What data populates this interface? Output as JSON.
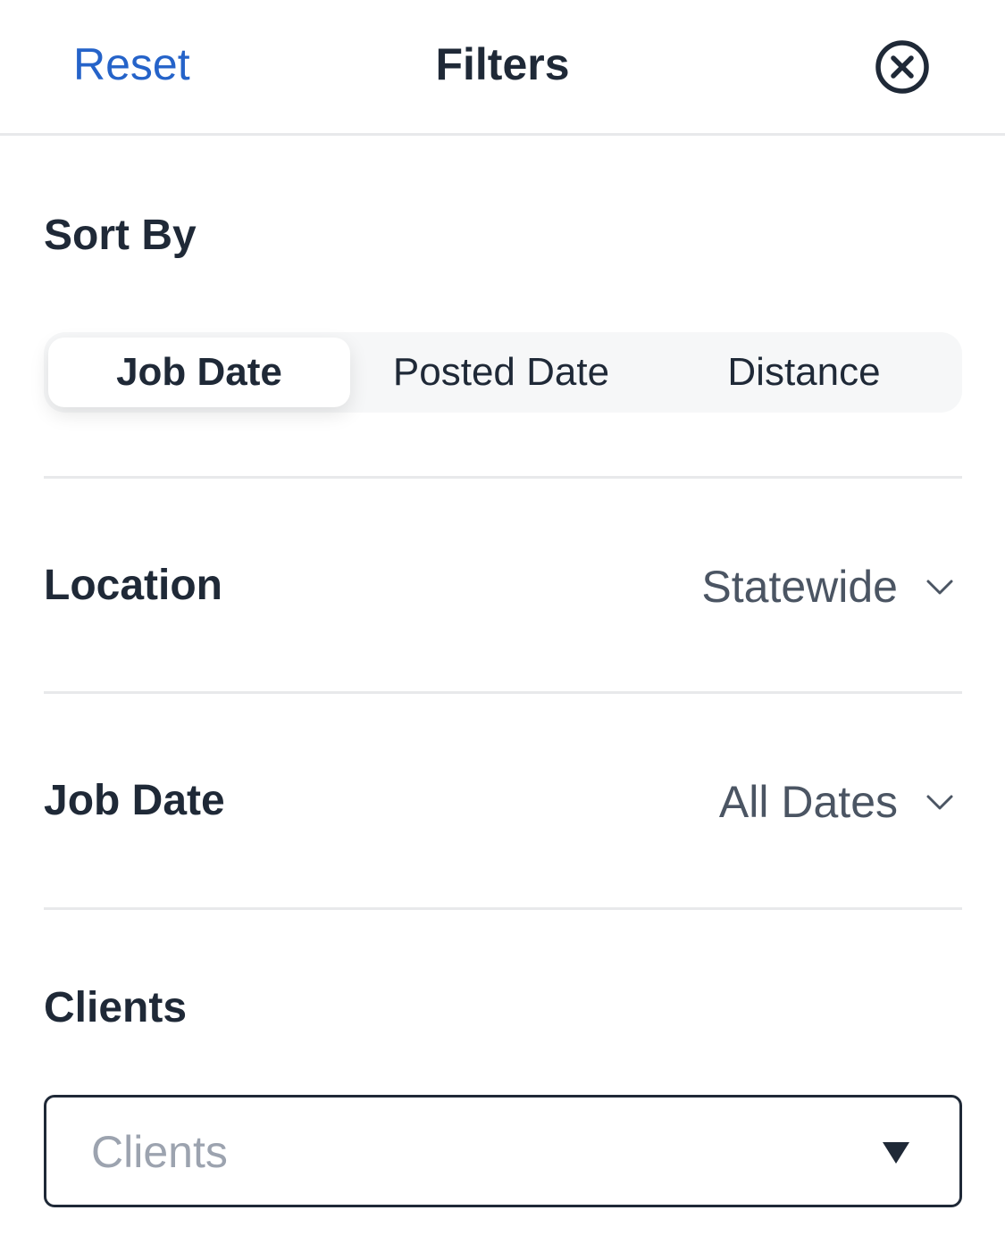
{
  "header": {
    "reset_label": "Reset",
    "title": "Filters",
    "close_icon": "close-circle-icon"
  },
  "sort_by": {
    "label": "Sort By",
    "options": [
      {
        "label": "Job Date",
        "selected": true
      },
      {
        "label": "Posted Date",
        "selected": false
      },
      {
        "label": "Distance",
        "selected": false
      }
    ]
  },
  "location": {
    "label": "Location",
    "value": "Statewide",
    "icon": "chevron-down-icon"
  },
  "job_date": {
    "label": "Job Date",
    "value": "All Dates",
    "icon": "chevron-down-icon"
  },
  "clients": {
    "label": "Clients",
    "placeholder": "Clients",
    "icon": "caret-down-icon"
  },
  "colors": {
    "accent": "#2563c9",
    "text": "#1f2937",
    "muted": "#4b5563",
    "placeholder": "#9ca3af",
    "divider": "#e8e9eb",
    "segment_bg": "#f6f7f8"
  }
}
